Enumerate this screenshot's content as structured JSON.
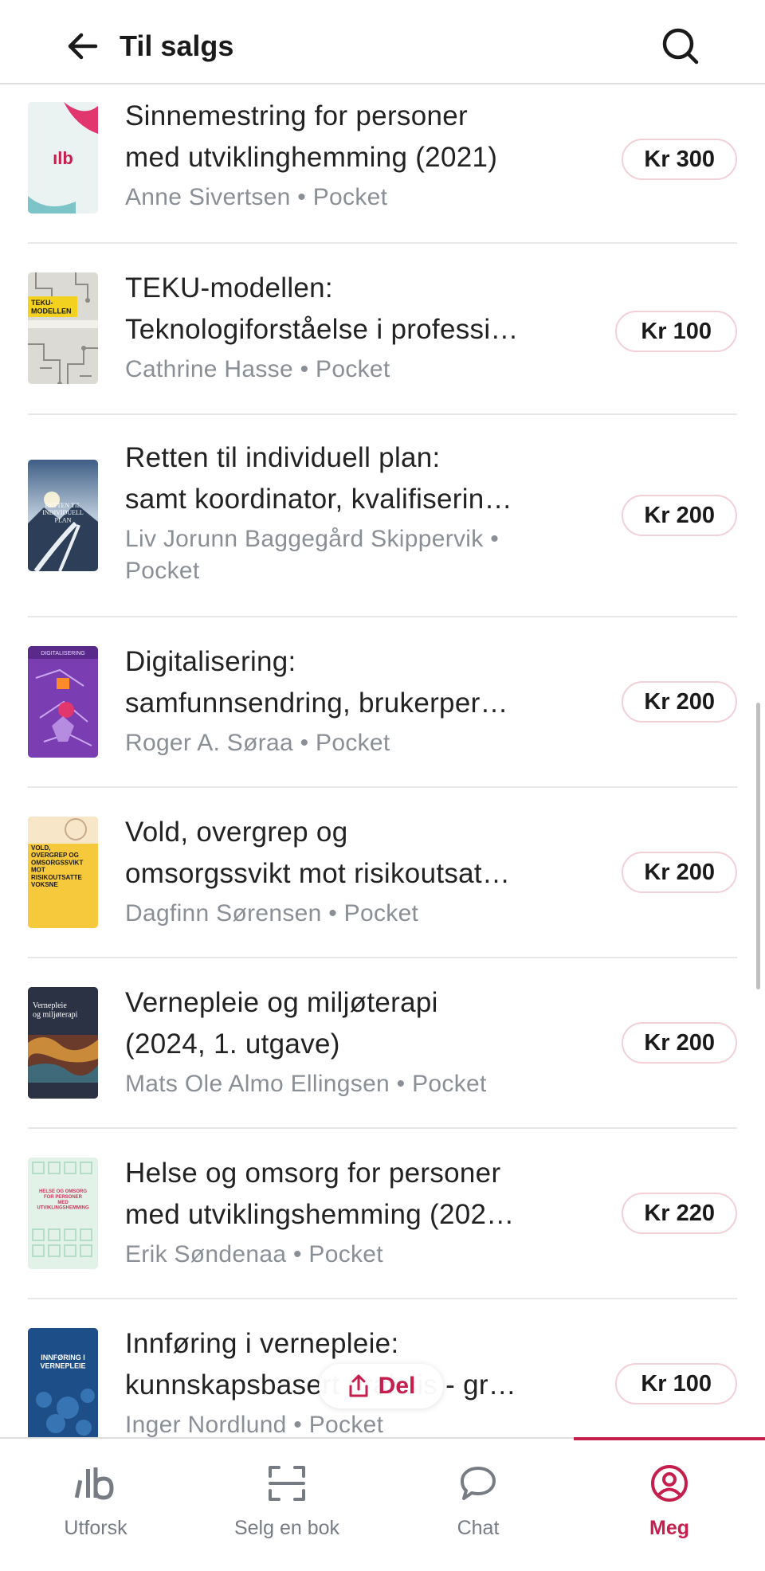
{
  "header": {
    "title": "Til salgs"
  },
  "books": [
    {
      "title_line1": "Sinnemestring for personer",
      "title_line2": "med utviklinghemming (2021)",
      "meta_line1": "Anne Sivertsen • Pocket",
      "meta_line2": "",
      "price": "Kr 300",
      "cover": "ilb-cover"
    },
    {
      "title_line1": "TEKU-modellen:",
      "title_line2": "Teknologiforståelse i professi…",
      "meta_line1": "Cathrine Hasse • Pocket",
      "meta_line2": "",
      "price": "Kr 100",
      "cover": "circuit-cover"
    },
    {
      "title_line1": "Retten til individuell plan:",
      "title_line2": "samt koordinator, kvalifiserin…",
      "meta_line1": "Liv Jorunn Baggegård Skippervik •",
      "meta_line2": "Pocket",
      "price": "Kr 200",
      "cover": "landscape-cover"
    },
    {
      "title_line1": "Digitalisering:",
      "title_line2": "samfunnsendring, brukerper…",
      "meta_line1": "Roger A. Søraa • Pocket",
      "meta_line2": "",
      "price": "Kr 200",
      "cover": "purple-cover"
    },
    {
      "title_line1": "Vold, overgrep og",
      "title_line2": "omsorgssvikt mot risikoutsat…",
      "meta_line1": "Dagfinn Sørensen • Pocket",
      "meta_line2": "",
      "price": "Kr 200",
      "cover": "yellow-cover"
    },
    {
      "title_line1": "Vernepleie og miljøterapi",
      "title_line2": "(2024, 1. utgave)",
      "meta_line1": "Mats Ole Almo Ellingsen • Pocket",
      "meta_line2": "",
      "price": "Kr 200",
      "cover": "painting-cover"
    },
    {
      "title_line1": "Helse og omsorg for personer",
      "title_line2": "med utviklingshemming (202…",
      "meta_line1": "Erik Søndenaa • Pocket",
      "meta_line2": "",
      "price": "Kr 220",
      "cover": "green-pattern-cover"
    },
    {
      "title_line1": "Innføring i vernepleie:",
      "title_line2": "kunnskapsbasert praksis - gr…",
      "meta_line1": "Inger Nordlund • Pocket",
      "meta_line2": "",
      "price": "Kr 100",
      "cover": "blue-cover"
    }
  ],
  "cover_text": {
    "ilb": "ılb",
    "teku": "TEKU-\nMODELLEN",
    "retten": "RETTEN TIL\nINDIVIDUELL\nPLAN",
    "digital": "DIGITALISERING",
    "vold": "VOLD,\nOVERGREP OG\nOMSORGSSVIKT\nMOT\nRISIKOUTSATTE\nVOKSNE",
    "verne": "Vernepleie\nog miljøterapi",
    "helse": "HELSE OG OMSORG\nFOR PERSONER\nMED\nUTVIKLINGSHEMMING",
    "innforing": "INNFØRING I\nVERNEPLEIE"
  },
  "share": {
    "label": "Del",
    "icon": "share-icon"
  },
  "nav": [
    {
      "label": "Utforsk",
      "icon": "ilb-logo-icon",
      "active": false
    },
    {
      "label": "Selg en bok",
      "icon": "scan-icon",
      "active": false
    },
    {
      "label": "Chat",
      "icon": "chat-bubble-icon",
      "active": false
    },
    {
      "label": "Meg",
      "icon": "profile-icon",
      "active": true
    }
  ],
  "colors": {
    "accent": "#c51f4e",
    "price_border": "#f3cfd7",
    "muted_text": "#8a8f96"
  }
}
